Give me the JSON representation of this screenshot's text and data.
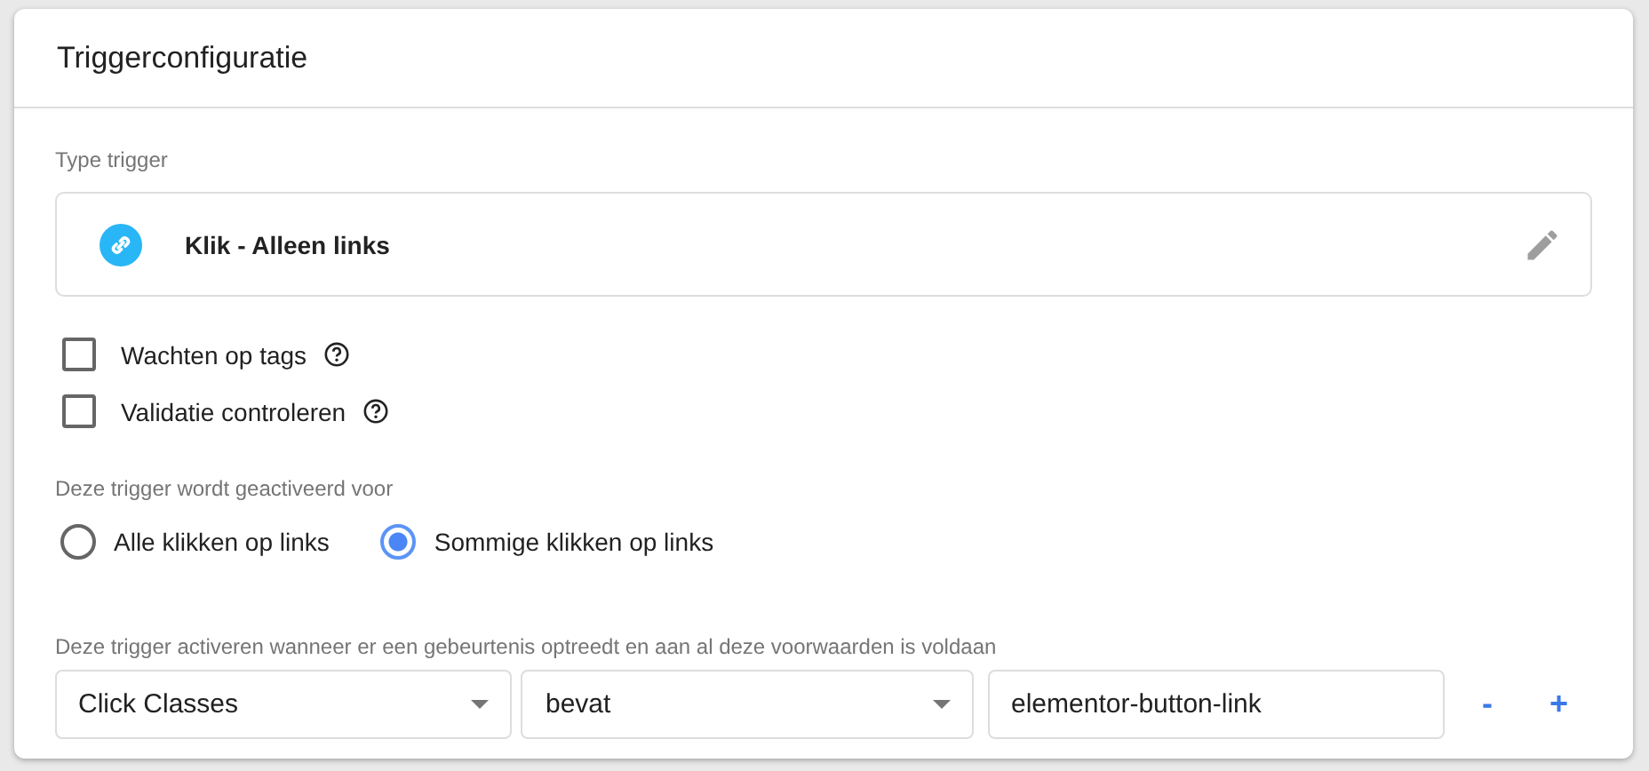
{
  "card": {
    "title": "Triggerconfiguratie"
  },
  "trigger_type": {
    "label": "Type trigger",
    "name": "Klik - Alleen links"
  },
  "options": [
    {
      "label": "Wachten op tags",
      "checked": false
    },
    {
      "label": "Validatie controleren",
      "checked": false
    }
  ],
  "fires_on": {
    "label": "Deze trigger wordt geactiveerd voor",
    "choices": [
      {
        "label": "Alle klikken op links",
        "selected": false
      },
      {
        "label": "Sommige klikken op links",
        "selected": true
      }
    ]
  },
  "conditions": {
    "label": "Deze trigger activeren wanneer er een gebeurtenis optreedt en aan al deze voorwaarden is voldaan",
    "rows": [
      {
        "variable": "Click Classes",
        "operator": "bevat",
        "value": "elementor-button-link",
        "remove": "-",
        "add": "+"
      }
    ]
  }
}
